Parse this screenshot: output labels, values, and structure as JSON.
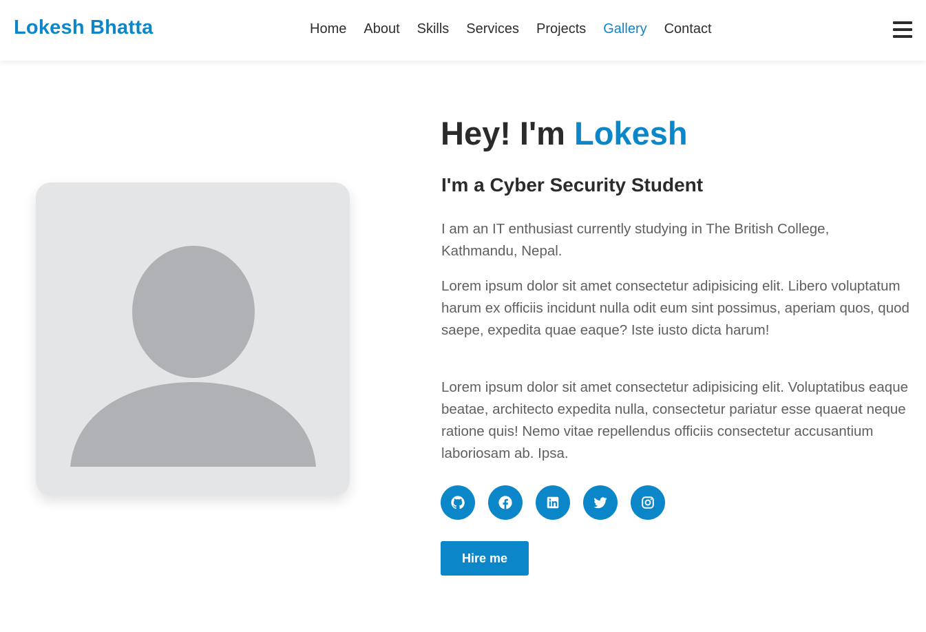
{
  "header": {
    "logo": "Lokesh Bhatta",
    "nav": [
      "Home",
      "About",
      "Skills",
      "Services",
      "Projects",
      "Gallery",
      "Contact"
    ],
    "active_nav": "Gallery"
  },
  "hero": {
    "title_prefix": "Hey! I'm ",
    "title_name": "Lokesh",
    "subtitle": "I'm a Cyber Security Student",
    "paragraphs": [
      "I am an IT enthusiast currently studying in The British College, Kathmandu, Nepal.",
      "Lorem ipsum dolor sit amet consectetur adipisicing elit. Libero voluptatum harum ex officiis incidunt nulla odit eum sint possimus, aperiam quos, quod saepe, expedita quae eaque? Iste iusto dicta harum!",
      "Lorem ipsum dolor sit amet consectetur adipisicing elit. Voluptatibus eaque beatae, architecto expedita nulla, consectetur pariatur esse quaerat neque ratione quis! Nemo vitae repellendus officiis consectetur accusantium laboriosam ab. Ipsa."
    ],
    "social_icons": [
      "github-icon",
      "facebook-icon",
      "linkedin-icon",
      "twitter-icon",
      "instagram-icon"
    ],
    "hire_label": "Hire me"
  },
  "colors": {
    "accent": "#0a86c9",
    "text": "#2b2b2b",
    "muted": "#5f5f5f",
    "placeholder_bg": "#e4e5e7",
    "placeholder_figure": "#aeb2b5"
  }
}
